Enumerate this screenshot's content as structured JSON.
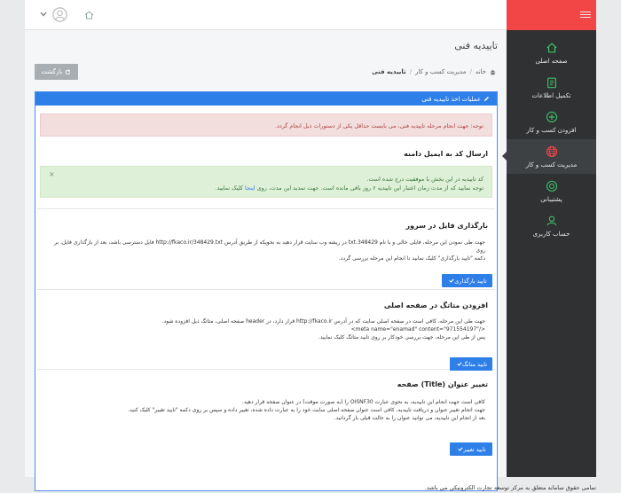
{
  "sidebar": {
    "items": [
      {
        "label": "صفحه اصلی",
        "icon": "home-icon"
      },
      {
        "label": "تکمیل اطلاعات",
        "icon": "clipboard-icon"
      },
      {
        "label": "افزودن کسب و کار",
        "icon": "plus-circle-icon"
      },
      {
        "label": "مدیریت کسب و کار",
        "icon": "globe-icon"
      },
      {
        "label": "پشتیبانی",
        "icon": "support-icon"
      },
      {
        "label": "حساب کاربری",
        "icon": "user-icon"
      }
    ]
  },
  "page": {
    "title": "تاییدیه فنی",
    "back_label": "بازگشت"
  },
  "breadcrumb": {
    "home": "خانه",
    "mid": "مدیریت کسب و کار",
    "current": "تاییدیه فنی"
  },
  "panel": {
    "heading": "عملیات اخذ تاییدیه فنی"
  },
  "alert_danger": "توجه: جهت انجام مرحله تاییدیه فنی، می بایست حداقل یکی از دستورات ذیل انجام گردد.",
  "email": {
    "title": "ارسال کد به ایمیل دامنه"
  },
  "alert_success": {
    "line1": "کد تاییدیه در این بخش با موفقیت درج شده است.",
    "line2_a": "توجه نمایید که از مدت زمان اعتبار این تاییدیه ۶ روز باقی مانده است. جهت تمدید این مدت، روی",
    "link": "اینجا",
    "line2_b": "کلیک نمایید."
  },
  "upload": {
    "title": "بارگذاری فایل در سرور",
    "line1": "جهت طی نمودن این مرحله، فایلی خالی و با نام 348429.txt در ریشه وب سایت قرار دهید به نحویکه از طریق آدرس http://fkaco.ir/348429.txt فایل دسترسی باشد، بعد از بارگذاری فایل، بر روی",
    "line2": "دکمه \"تایید بارگذاری\" کلیک نمایید تا انجام این مرحله بررسی گردد.",
    "button": "تایید بارگذاری"
  },
  "meta": {
    "title": "افزودن متاتگ در صفحه اصلی",
    "line1": "جهت طی این مرحله، کافی است در صفحه اصلی سایت که در آدرس http://fkaco.ir قرار دارد، در header صفحه اصلی، متاتگ ذیل افزوده شود.",
    "code": "<meta name=\"enamad\" content=\"971554197\"/>",
    "line3": "پس از طی این مرحله، جهت بررسی خودکار بر روی تایید متاتگ کلیک نمایید.",
    "button": "تایید متاتگ"
  },
  "titlesec": {
    "title": "تغییر عنوان (Title) صفحه",
    "line1": "کافی است جهت انجام این تاییدیه، به نحوی عبارت OISNF30 را (به صورت موقت) در عنوان صفحه قرار دهید.",
    "line2": "جهت انجام تغییر عنوان و دریافت تاییدیه، کافی است عنوان صفحه اصلی سایت خود را به عبارت داده شده، تغییر داده و سپس بر روی دکمه \"تایید تغییر\" کلیک کنید.",
    "line3": "بعد از انجام این تاییدیه، می توانید عنوان را به حالت قبلی باز گردانید.",
    "button": "تایید تغییر"
  },
  "footer": "تمامی حقوق سامانه متعلق به مرکز توسعه تجارت الکترونیکی می باشد.",
  "colors": {
    "brand": "#f24646",
    "primary": "#2f7fe8",
    "sidebar": "#2f3133",
    "nav_icon": "#3fbf6a"
  }
}
